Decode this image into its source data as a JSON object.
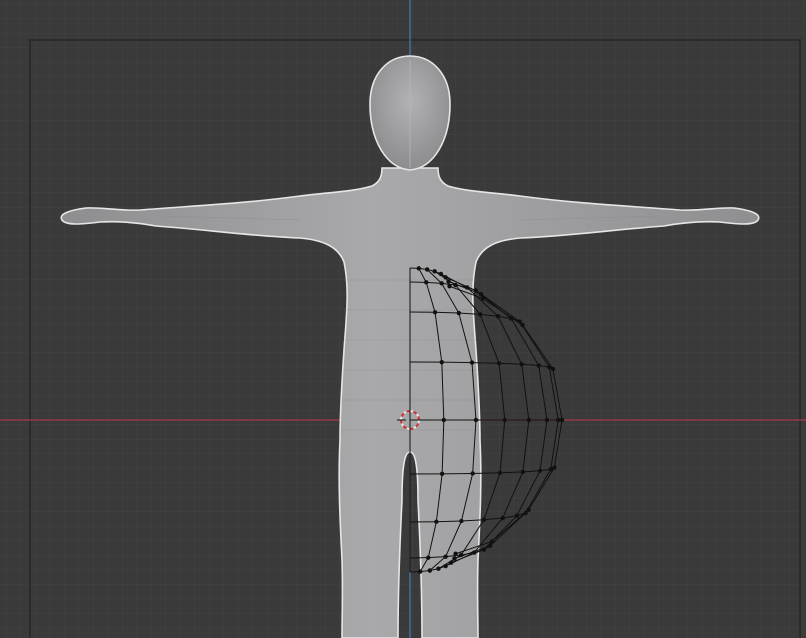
{
  "viewport": {
    "view": "front-orthographic",
    "background_color": "#3a3a3a",
    "grid_minor_color": "#444444",
    "grid_major_color": "#2f2f2f",
    "x_axis_color": "#a33c4b",
    "z_axis_color": "#4a7ab5",
    "grid_visible": true
  },
  "scene": {
    "model": {
      "icon": "humanoid-mesh-icon",
      "pose": "T-pose",
      "shading": "solid",
      "body_color": "#9c9c9e",
      "outline_color": "#e6e6e6"
    },
    "cage": {
      "icon": "lattice-cage-icon",
      "wire_color": "#111111",
      "vertex_color": "#111111"
    },
    "cursor": {
      "icon": "3d-cursor-icon",
      "ring_color_a": "#e6e6e6",
      "ring_color_b": "#cc3333"
    }
  }
}
